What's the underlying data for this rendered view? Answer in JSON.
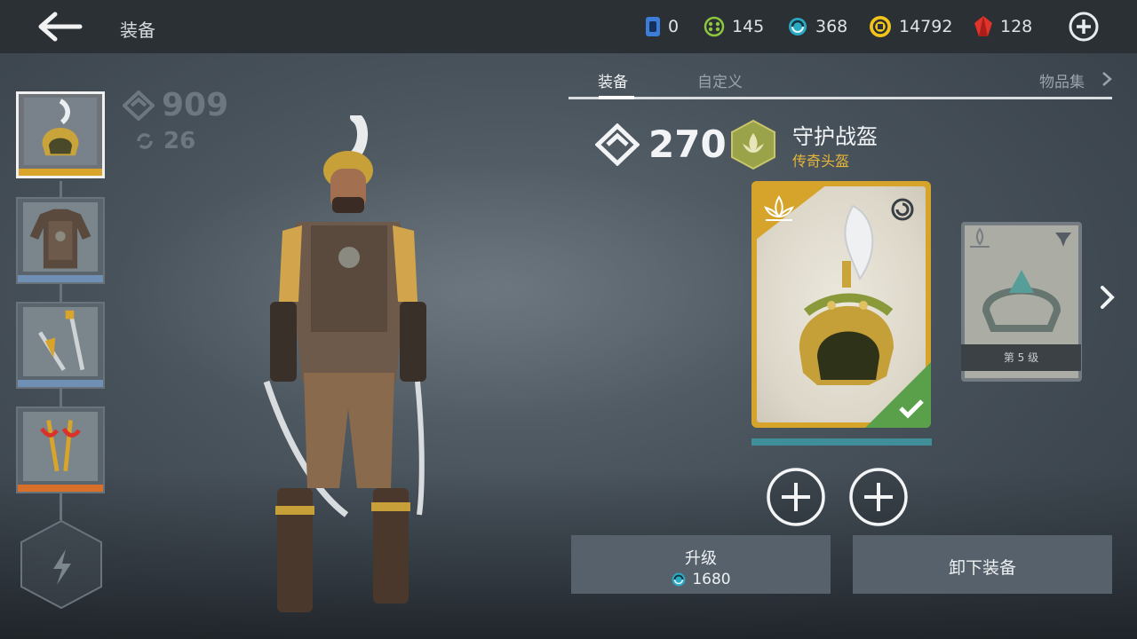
{
  "header": {
    "title": "装备",
    "currencies": [
      {
        "icon": "blue-token-icon",
        "value": "0",
        "color": "#3c7dd8"
      },
      {
        "icon": "green-orb-icon",
        "value": "145",
        "color": "#8dc63f"
      },
      {
        "icon": "cyan-swirl-icon",
        "value": "368",
        "color": "#2aa9c4"
      },
      {
        "icon": "gold-coin-icon",
        "value": "14792",
        "color": "#f0c419"
      },
      {
        "icon": "red-gem-icon",
        "value": "128",
        "color": "#e0332b"
      }
    ]
  },
  "character": {
    "power": "909",
    "upgrade_count": "26"
  },
  "slots": [
    {
      "name": "helmet",
      "bar_color": "#d9a42a",
      "selected": true
    },
    {
      "name": "armor",
      "bar_color": "#6f8fb5",
      "selected": false
    },
    {
      "name": "weapon",
      "bar_color": "#6f8fb5",
      "selected": false
    },
    {
      "name": "ranged",
      "bar_color": "#d9702a",
      "selected": false
    }
  ],
  "tabs": {
    "equip": "装备",
    "customize": "自定义",
    "collection": "物品集"
  },
  "item": {
    "power": "270",
    "name": "守护战盔",
    "rarity": "传奇头盔",
    "rarity_color": "#e7b73a",
    "next_card_level": "第 5 级"
  },
  "actions": {
    "upgrade_label": "升级",
    "upgrade_cost": "1680",
    "unequip_label": "卸下装备"
  }
}
